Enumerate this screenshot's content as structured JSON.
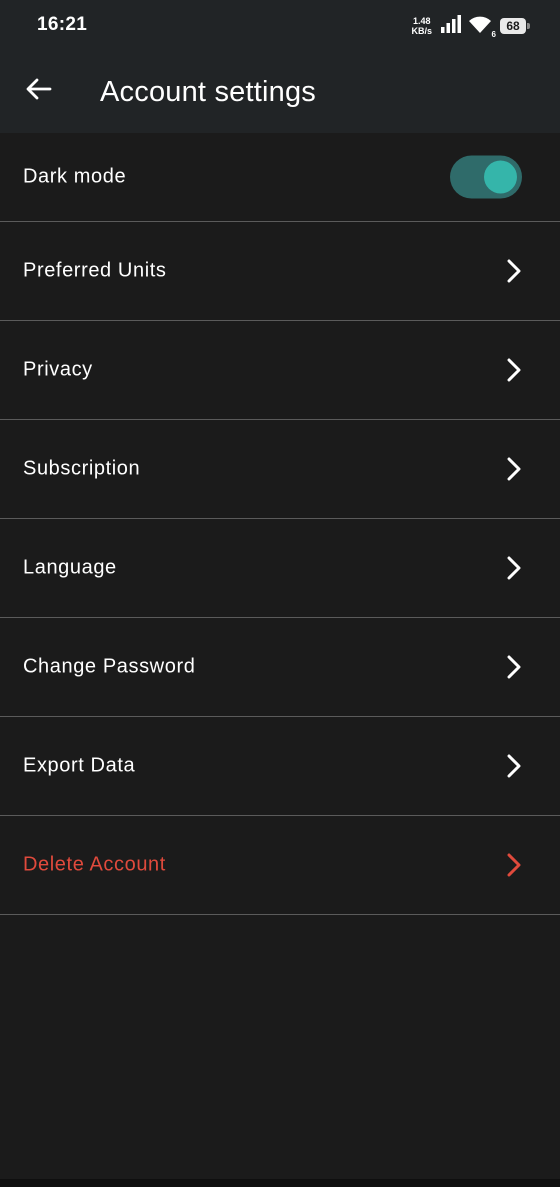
{
  "status_bar": {
    "time": "16:21",
    "net_speed_value": "1.48",
    "net_speed_unit": "KB/s",
    "wifi_badge": "6",
    "battery": "68"
  },
  "app_bar": {
    "title": "Account settings",
    "back_icon": "arrow-left-icon"
  },
  "settings": {
    "dark_mode": {
      "label": "Dark mode",
      "enabled": true,
      "track_color": "#2f6b6a",
      "thumb_color": "#35b5aa"
    },
    "items": [
      {
        "label": "Preferred Units",
        "icon": "chevron-right-icon"
      },
      {
        "label": "Privacy",
        "icon": "chevron-right-icon"
      },
      {
        "label": "Subscription",
        "icon": "chevron-right-icon"
      },
      {
        "label": "Language",
        "icon": "chevron-right-icon"
      },
      {
        "label": "Change Password",
        "icon": "chevron-right-icon"
      },
      {
        "label": "Export Data",
        "icon": "chevron-right-icon"
      },
      {
        "label": "Delete Account",
        "icon": "chevron-right-icon",
        "color": "#e04a3c"
      }
    ]
  },
  "colors": {
    "background": "#1b1b1b",
    "app_bar": "#212426",
    "danger": "#e04a3c",
    "divider": "#5b5b5b"
  }
}
